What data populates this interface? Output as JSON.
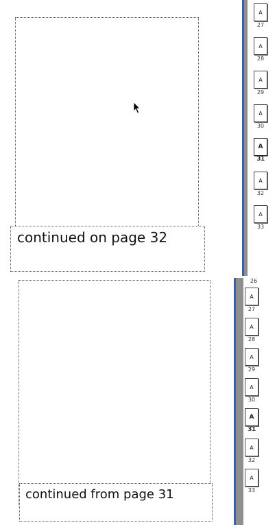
{
  "top_view": {
    "caption": "continued on page 32",
    "page_strip": [
      {
        "letter": "A",
        "number": "27",
        "current": false
      },
      {
        "letter": "A",
        "number": "28",
        "current": false
      },
      {
        "letter": "A",
        "number": "29",
        "current": false
      },
      {
        "letter": "A",
        "number": "30",
        "current": false
      },
      {
        "letter": "A",
        "number": "31",
        "current": true
      },
      {
        "letter": "A",
        "number": "32",
        "current": false
      },
      {
        "letter": "A",
        "number": "33",
        "current": false
      }
    ]
  },
  "bottom_view": {
    "caption": "continued from page 31",
    "top_number": "26",
    "page_strip": [
      {
        "letter": "A",
        "number": "27",
        "current": false
      },
      {
        "letter": "A",
        "number": "28",
        "current": false
      },
      {
        "letter": "A",
        "number": "29",
        "current": false
      },
      {
        "letter": "A",
        "number": "30",
        "current": false
      },
      {
        "letter": "A",
        "number": "31",
        "current": true
      },
      {
        "letter": "A",
        "number": "32",
        "current": false
      },
      {
        "letter": "A",
        "number": "33",
        "current": false
      }
    ]
  },
  "colors": {
    "strip_gray": "#8f8f8f",
    "strip_edge_blue": "#3d5fa8"
  },
  "icons": {
    "cursor": "arrow-pointer-icon"
  }
}
